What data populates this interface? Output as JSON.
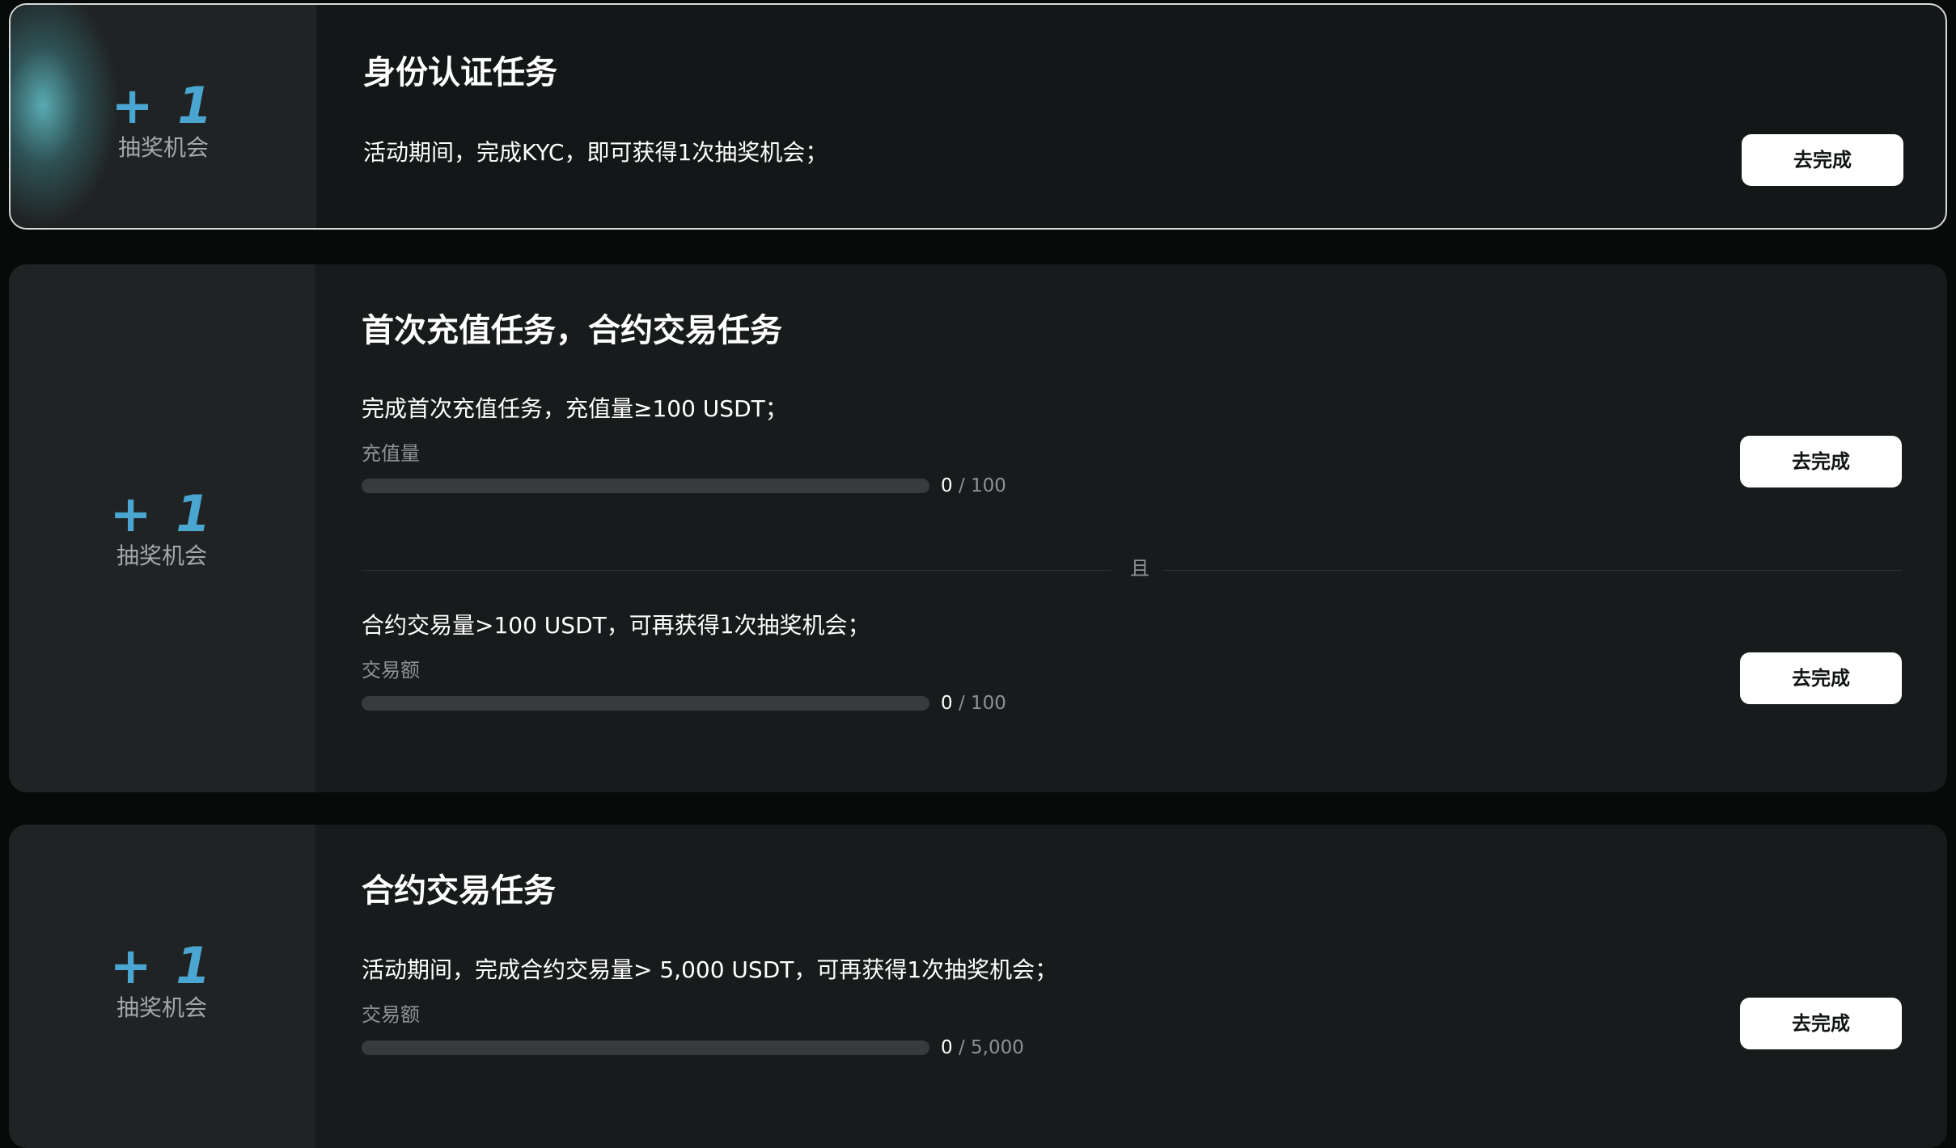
{
  "tasks": [
    {
      "reward": {
        "amount": "+ 1",
        "label": "抽奖机会"
      },
      "title": "身份认证任务",
      "items": [
        {
          "description": "活动期间，完成KYC，即可获得1次抽奖机会；",
          "button": "去完成"
        }
      ]
    },
    {
      "reward": {
        "amount": "+ 1",
        "label": "抽奖机会"
      },
      "title": "首次充值任务，合约交易任务",
      "divider": "且",
      "items": [
        {
          "description": "完成首次充值任务，充值量≥100 USDT；",
          "metric_label": "充值量",
          "progress": {
            "current": "0",
            "separator": "/",
            "target": "100",
            "fraction": 0
          },
          "button": "去完成"
        },
        {
          "description": "合约交易量>100 USDT，可再获得1次抽奖机会；",
          "metric_label": "交易额",
          "progress": {
            "current": "0",
            "separator": "/",
            "target": "100",
            "fraction": 0
          },
          "button": "去完成"
        }
      ]
    },
    {
      "reward": {
        "amount": "+ 1",
        "label": "抽奖机会"
      },
      "title": "合约交易任务",
      "items": [
        {
          "description": "活动期间，完成合约交易量> 5,000 USDT，可再获得1次抽奖机会；",
          "metric_label": "交易额",
          "progress": {
            "current": "0",
            "separator": "/",
            "target": "5,000",
            "fraction": 0
          },
          "button": "去完成"
        }
      ]
    }
  ],
  "colors": {
    "accent": "#4aa6d1",
    "card_bg": "#181b1b",
    "page_bg": "#070a09",
    "button_bg": "#ffffff"
  }
}
